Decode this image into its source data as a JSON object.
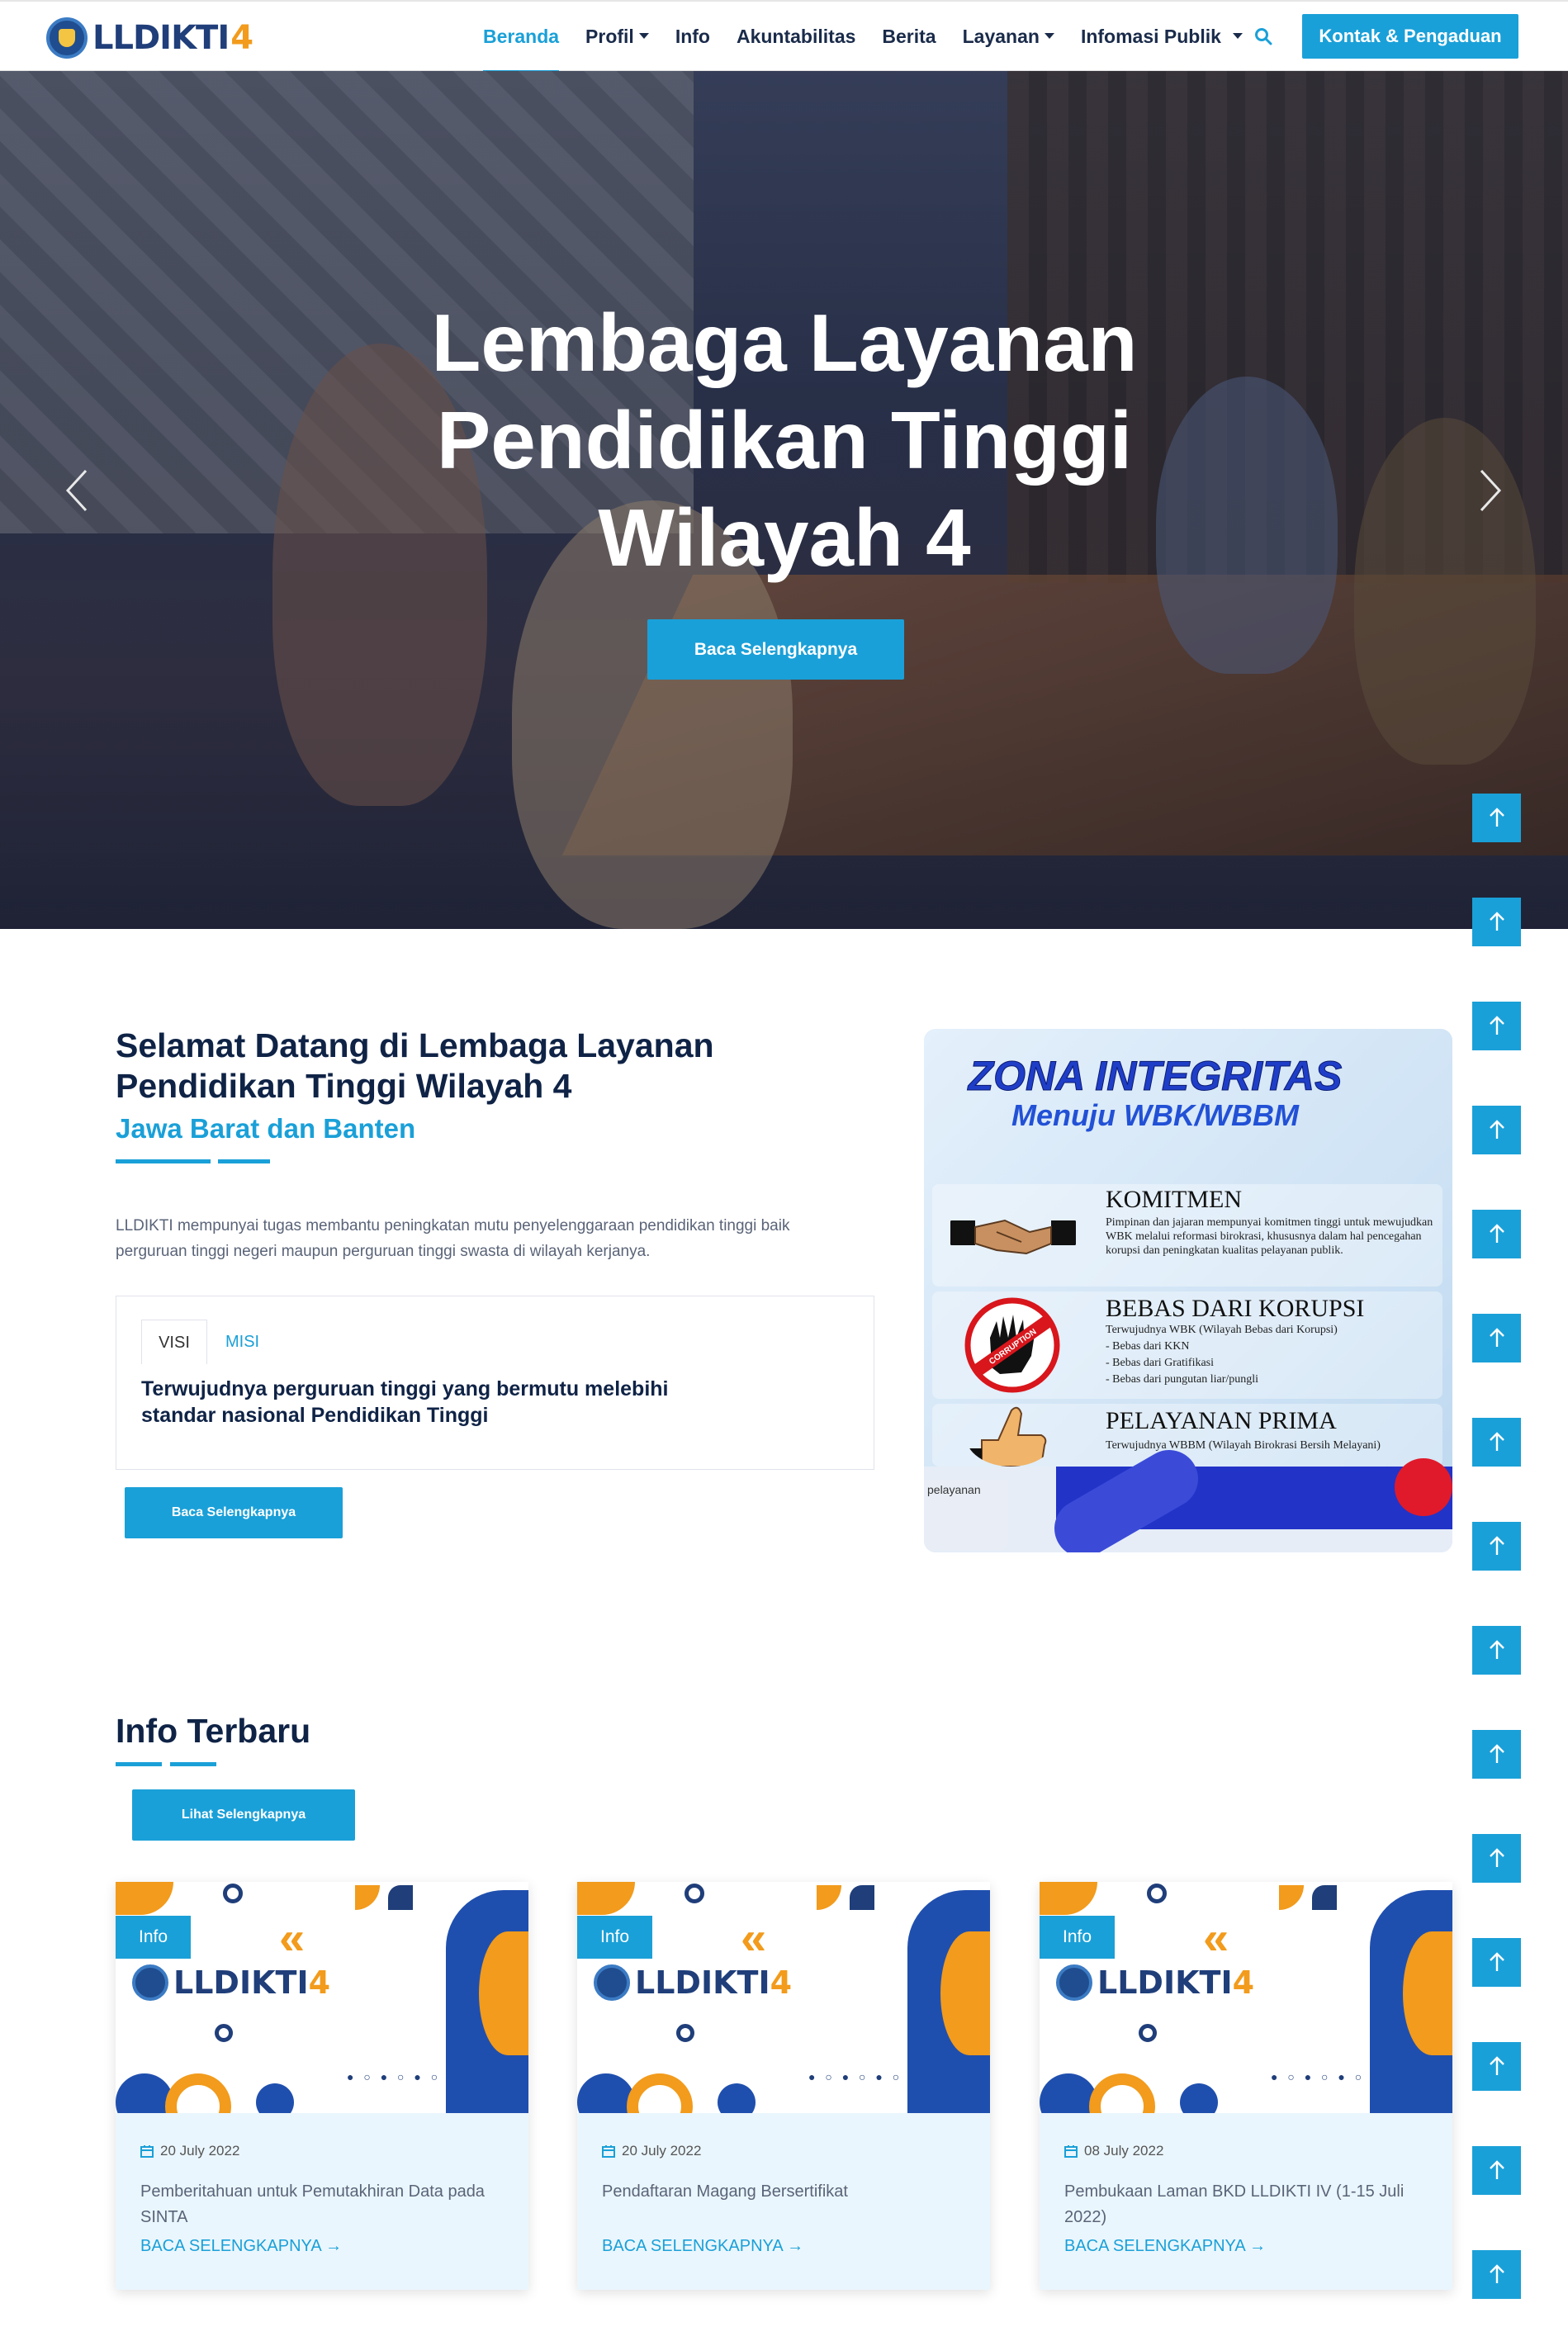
{
  "nav": {
    "logo_text": "LLDIKTI",
    "logo_num": "4",
    "items": [
      {
        "label": "Beranda",
        "active": true,
        "dropdown": false
      },
      {
        "label": "Profil",
        "active": false,
        "dropdown": true
      },
      {
        "label": "Info",
        "active": false,
        "dropdown": false
      },
      {
        "label": "Akuntabilitas",
        "active": false,
        "dropdown": false
      },
      {
        "label": "Berita",
        "active": false,
        "dropdown": false
      },
      {
        "label": "Layanan",
        "active": false,
        "dropdown": true
      },
      {
        "label": "Infomasi Publik",
        "active": false,
        "dropdown": true
      }
    ],
    "search_icon": "search-icon",
    "contact_button": "Kontak & Pengaduan"
  },
  "hero": {
    "title_line1": "Lembaga Layanan",
    "title_line2": "Pendidikan Tinggi",
    "title_line3": "Wilayah 4",
    "button": "Baca Selengkapnya"
  },
  "welcome": {
    "title_line1": "Selamat Datang di Lembaga Layanan",
    "title_line2": "Pendidikan Tinggi Wilayah 4",
    "subtitle": "Jawa Barat dan Banten",
    "description": "LLDIKTI mempunyai tugas membantu peningkatan mutu penyelenggaraan pendidikan tinggi baik perguruan tinggi negeri maupun perguruan tinggi swasta di wilayah kerjanya.",
    "tabs": {
      "visi": "VISI",
      "misi": "MISI"
    },
    "visi_text": "Terwujudnya perguruan tinggi yang bermutu melebihi standar nasional Pendidikan Tinggi",
    "button": "Baca Selengkapnya"
  },
  "zona": {
    "title1": "ZONA INTEGRITAS",
    "title2": "Menuju WBK/WBBM",
    "items": [
      {
        "heading": "KOMITMEN",
        "text": "Pimpinan dan jajaran mempunyai komitmen tinggi untuk mewujudkan WBK melalui reformasi birokrasi, khususnya dalam hal pencegahan korupsi dan peningkatan kualitas pelayanan publik."
      },
      {
        "heading": "BEBAS DARI KORUPSI",
        "text": "Terwujudnya WBK (Wilayah Bebas dari Korupsi)",
        "bullets": [
          "- Bebas dari KKN",
          "- Bebas dari Gratifikasi",
          "- Bebas dari pungutan liar/pungli"
        ]
      },
      {
        "heading": "PELAYANAN PRIMA",
        "text": "Terwujudnya WBBM (Wilayah Birokrasi Bersih Melayani)"
      }
    ],
    "tab_fragment": "pelayanan",
    "corruption_label": "CORRUPTION"
  },
  "info": {
    "title": "Info Terbaru",
    "button": "Lihat Selengkapnya",
    "cards": [
      {
        "badge": "Info",
        "logo": "LLDIKTI",
        "logo_num": "4",
        "date": "20 July 2022",
        "title": "Pemberitahuan untuk Pemutakhiran Data pada SINTA",
        "link": "BACA SELENGKAPNYA →"
      },
      {
        "badge": "Info",
        "logo": "LLDIKTI",
        "logo_num": "4",
        "date": "20 July 2022",
        "title": "Pendaftaran Magang Bersertifikat",
        "link": "BACA SELENGKAPNYA →"
      },
      {
        "badge": "Info",
        "logo": "LLDIKTI",
        "logo_num": "4",
        "date": "08 July 2022",
        "title": "Pembukaan Laman BKD LLDIKTI IV (1-15 Juli 2022)",
        "link": "BACA SELENGKAPNYA →"
      }
    ]
  },
  "colors": {
    "accent": "#1aa0d8",
    "heading": "#0f2346",
    "card_body": "#eaf6fd"
  },
  "scroll_top_buttons": 15
}
